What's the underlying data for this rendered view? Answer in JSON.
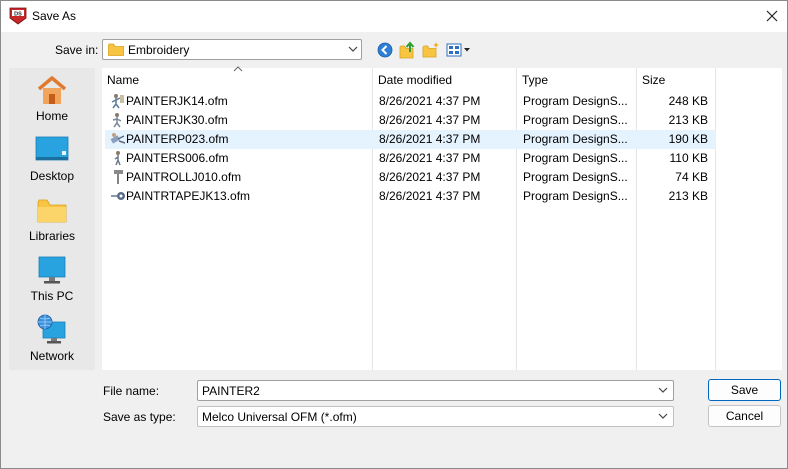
{
  "window": {
    "title": "Save As",
    "app_icon": "designshop-app-icon"
  },
  "toolbar": {
    "save_in_label": "Save in:",
    "save_in_value": "Embroidery",
    "buttons": [
      "back-icon",
      "up-folder-icon",
      "new-folder-icon",
      "view-menu-icon"
    ]
  },
  "places": [
    {
      "label": "Home",
      "icon": "home-icon"
    },
    {
      "label": "Desktop",
      "icon": "desktop-icon"
    },
    {
      "label": "Libraries",
      "icon": "libraries-icon"
    },
    {
      "label": "This PC",
      "icon": "this-pc-icon"
    },
    {
      "label": "Network",
      "icon": "network-icon"
    }
  ],
  "file_list": {
    "columns": [
      "Name",
      "Date modified",
      "Type",
      "Size"
    ],
    "sorted_by": "Name",
    "rows": [
      {
        "name": "PAINTERJK14.ofm",
        "date": "8/26/2021 4:37 PM",
        "type": "Program DesignS...",
        "size": "248 KB",
        "selected": false
      },
      {
        "name": "PAINTERJK30.ofm",
        "date": "8/26/2021 4:37 PM",
        "type": "Program DesignS...",
        "size": "213 KB",
        "selected": false
      },
      {
        "name": "PAINTERP023.ofm",
        "date": "8/26/2021 4:37 PM",
        "type": "Program DesignS...",
        "size": "190 KB",
        "selected": true
      },
      {
        "name": "PAINTERS006.ofm",
        "date": "8/26/2021 4:37 PM",
        "type": "Program DesignS...",
        "size": "110 KB",
        "selected": false
      },
      {
        "name": "PAINTROLLJ010.ofm",
        "date": "8/26/2021 4:37 PM",
        "type": "Program DesignS...",
        "size": "74 KB",
        "selected": false
      },
      {
        "name": "PAINTRTAPEJK13.ofm",
        "date": "8/26/2021 4:37 PM",
        "type": "Program DesignS...",
        "size": "213 KB",
        "selected": false
      }
    ]
  },
  "footer": {
    "file_name_label": "File name:",
    "file_name_value": "PAINTER2",
    "save_type_label": "Save as type:",
    "save_type_value": "Melco Universal OFM (*.ofm)",
    "save_button": "Save",
    "cancel_button": "Cancel"
  },
  "colors": {
    "accent": "#0067c0",
    "selection": "#e5f3ff",
    "folder": "#f8c542"
  }
}
